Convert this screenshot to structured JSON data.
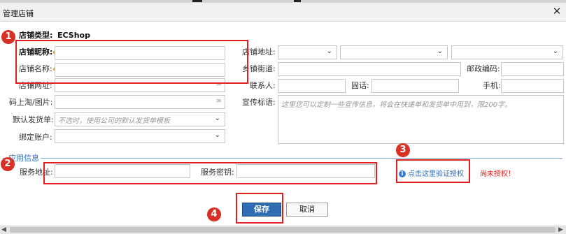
{
  "window": {
    "title": "管理店铺"
  },
  "store": {
    "type_label": "店铺类型:",
    "type_value": "ECShop",
    "nickname_label": "店铺昵称:",
    "name_label": "店铺名称:",
    "url_label": "店铺网址:",
    "qr_label": "码上淘/图片:",
    "template_label": "默认发货单:",
    "template_placeholder": "不选时，使用公司的默认发货单模板",
    "account_label": "绑定账户:",
    "address_label": "店铺地址:",
    "street_label": "乡镇街道:",
    "postcode_label": "邮政编码:",
    "contact_label": "联系人:",
    "phone_label": "固话:",
    "mobile_label": "手机:",
    "slogan_label": "宣传标语:",
    "slogan_placeholder": "这里您可以定制一些宣传信息，将会在快递单和发货单中用到，限200字。"
  },
  "app_info": {
    "legend": "应用信息",
    "service_address_label": "服务地址:",
    "service_secret_label": "服务密钥:",
    "verify_link": "点击这里验证授权",
    "status": "尚未授权！"
  },
  "buttons": {
    "save": "保存",
    "cancel": "取消"
  },
  "annotations": [
    "1",
    "2",
    "3",
    "4"
  ],
  "colors": {
    "accent": "#2f6db3",
    "annotation": "#e02020",
    "legend": "#2a6fb8"
  },
  "icons": {
    "link": "link-icon",
    "info": "info-icon",
    "dropdown": "chevron-down-icon",
    "close": "close-icon"
  }
}
